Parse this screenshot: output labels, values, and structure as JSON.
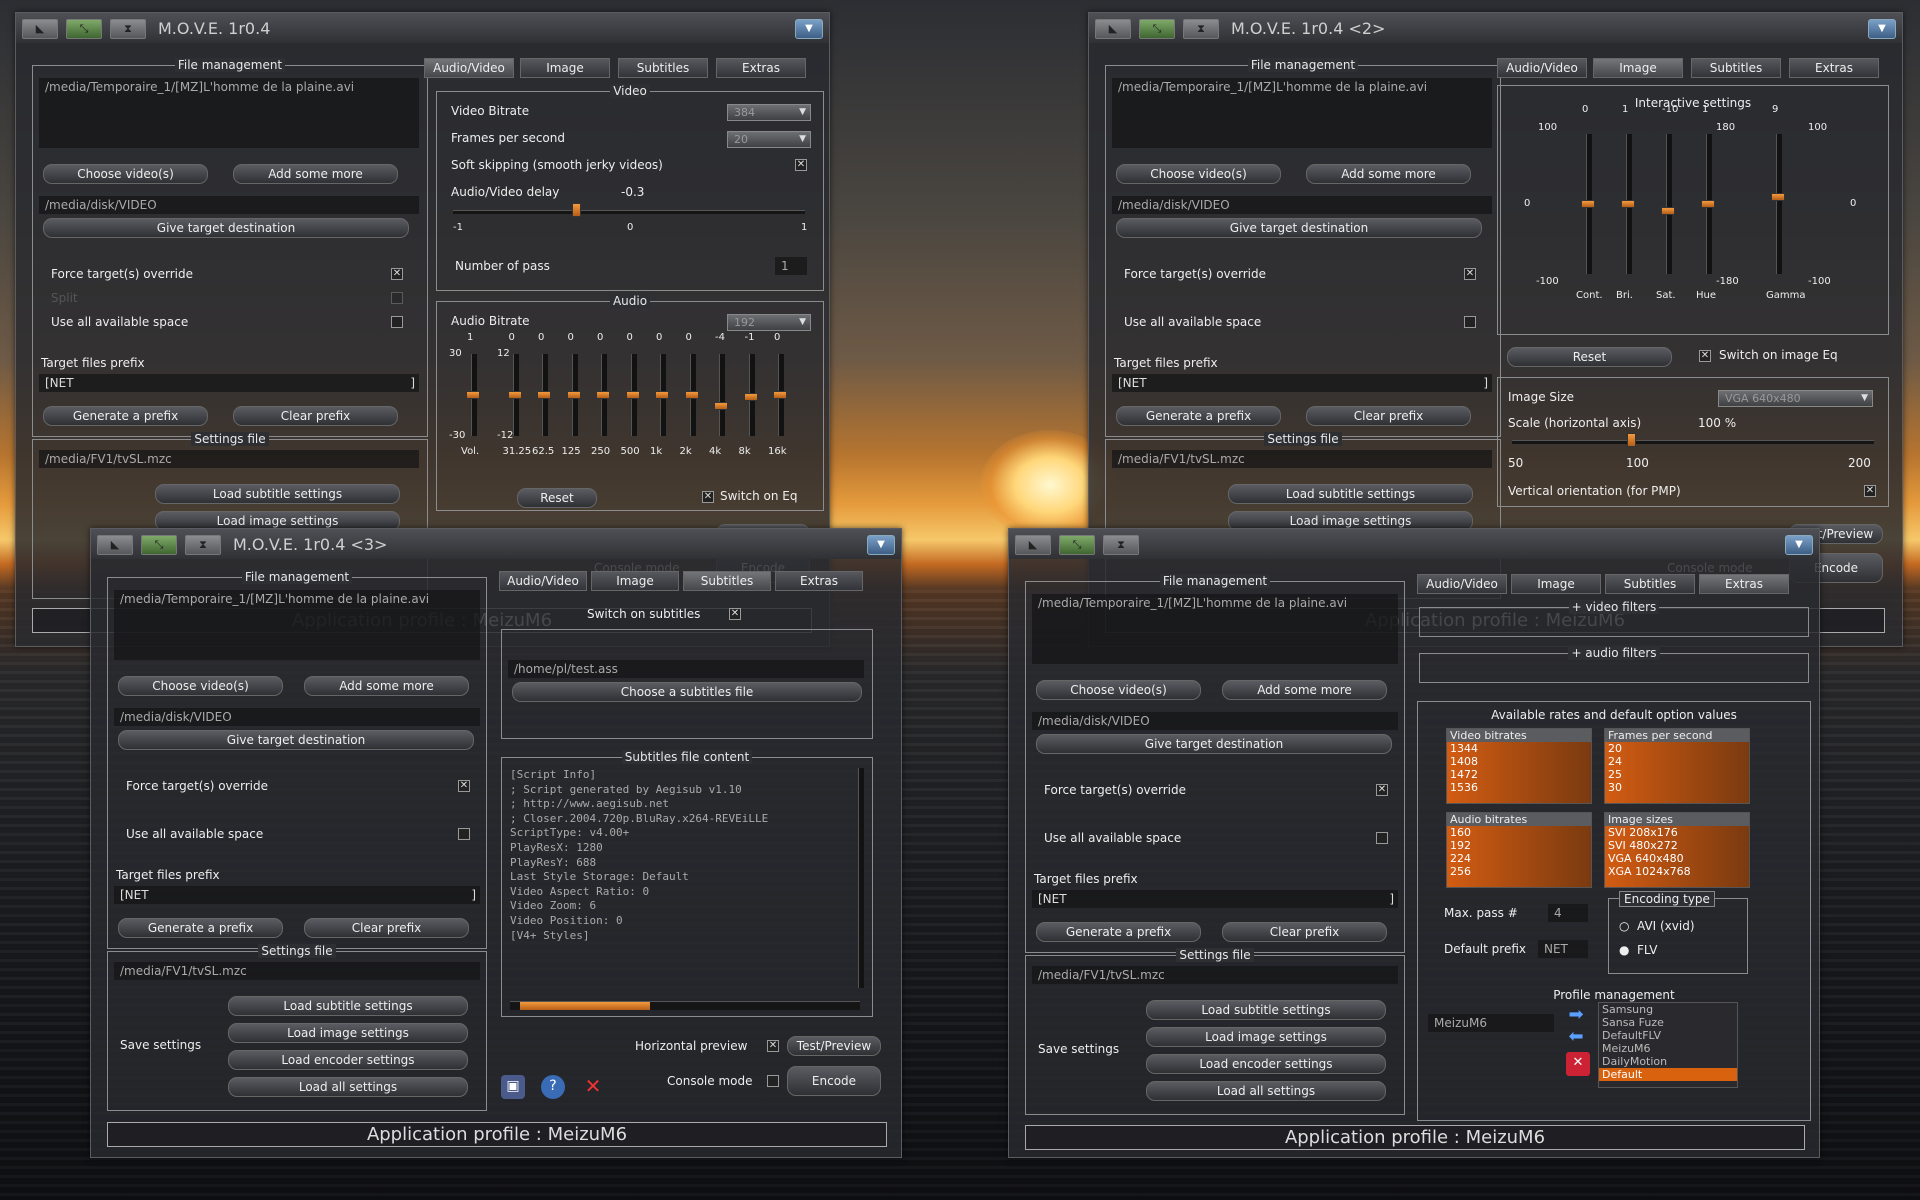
{
  "common": {
    "file_mgmt": "File management",
    "source_path": "/media/Temporaire_1/[MZ]L'homme de la plaine.avi",
    "choose_videos": "Choose video(s)",
    "add_more": "Add some more",
    "dest_path": "/media/disk/VIDEO",
    "give_dest": "Give target destination",
    "force_override": "Force target(s) override",
    "hidden_option": "Split",
    "use_space": "Use all available space",
    "prefix_label": "Target files prefix",
    "prefix_value": "[NET",
    "prefix_end": "]",
    "gen_prefix": "Generate a prefix",
    "clear_prefix": "Clear prefix",
    "settings_file": "Settings file",
    "settings_path": "/media/FV1/tvSL.mzc",
    "save_settings": "Save settings",
    "load_sub": "Load subtitle settings",
    "load_img": "Load image settings",
    "load_enc": "Load encoder settings",
    "load_all": "Load all settings",
    "hpreview": "Horizontal preview",
    "test_preview": "Test/Preview",
    "console_mode": "Console mode",
    "encode": "Encode",
    "profile": "Application profile : MeizuM6",
    "tab_av": "Audio/Video",
    "tab_img": "Image",
    "tab_sub": "Subtitles",
    "tab_extra": "Extras",
    "min_icon": "▼",
    "x": "✕"
  },
  "win1": {
    "title": "M.O.V.E. 1r0.4",
    "video": {
      "legend": "Video",
      "bitrate_label": "Video Bitrate",
      "bitrate": "384",
      "fps_label": "Frames per second",
      "fps": "20",
      "soft_skip": "Soft skipping (smooth jerky videos)",
      "delay_label": "Audio/Video delay",
      "delay": "-0.3",
      "delay_fraction": 0.35,
      "tick_min": "-1",
      "tick_mid": "0",
      "tick_max": "1",
      "pass_label": "Number of pass",
      "pass": "1"
    },
    "audio": {
      "legend": "Audio",
      "bitrate_label": "Audio Bitrate",
      "bitrate": "192",
      "values": [
        "1",
        "0",
        "0",
        "0",
        "0",
        "0",
        "0",
        "0",
        "-4",
        "-1",
        "0"
      ],
      "levels": [
        0.5,
        0.5,
        0.5,
        0.5,
        0.5,
        0.5,
        0.5,
        0.5,
        0.63,
        0.53,
        0.5
      ],
      "freqs": [
        "Vol.",
        "31.25",
        "62.5",
        "125",
        "250",
        "500",
        "1k",
        "2k",
        "4k",
        "8k",
        "16k"
      ],
      "scale_top": "30",
      "scale_bot": "-30",
      "scale2_top": "12",
      "scale2_bot": "-12",
      "reset": "Reset",
      "switch_eq": "Switch on Eq"
    }
  },
  "win2": {
    "title": "M.O.V.E. 1r0.4 <2>",
    "interactive": "Interactive settings",
    "vals": [
      "0",
      "1",
      "-10",
      "1",
      "9"
    ],
    "names": [
      "Cont.",
      "Bri.",
      "Sat.",
      "Hue",
      "Gamma"
    ],
    "levels": [
      0.5,
      0.5,
      0.55,
      0.5,
      0.45
    ],
    "left_top": "100",
    "left_mid": "0",
    "left_bot": "-100",
    "hue_top": "180",
    "hue_bot": "-180",
    "right_top": "100",
    "right_mid": "0",
    "right_bot": "-100",
    "reset": "Reset",
    "switch_img": "Switch on image Eq",
    "img_size": "Image Size",
    "img_size_val": "VGA 640x480",
    "scale_label": "Scale (horizontal axis)",
    "scale_val": "100 %",
    "scale_fraction": 0.33,
    "s_min": "50",
    "s_mid": "100",
    "s_max": "200",
    "vertical": "Vertical orientation (for PMP)"
  },
  "win3": {
    "title": "M.O.V.E. 1r0.4 <3>",
    "switch_sub": "Switch on subtitles",
    "sub_path": "/home/pl/test.ass",
    "choose_sub": "Choose a subtitles file",
    "sub_content": "Subtitles file content",
    "lines": [
      "[Script Info]",
      "; Script generated by Aegisub v1.10",
      "; http://www.aegisub.net",
      "; Closer.2004.720p.BluRay.x264-REVEiLLE",
      "ScriptType: v4.00+",
      "PlayResX: 1280",
      "PlayResY: 688",
      "Last Style Storage: Default",
      "Video Aspect Ratio: 0",
      "Video Zoom: 6",
      "Video Position: 0",
      "",
      "[V4+ Styles]"
    ]
  },
  "win4": {
    "video_filters": "+ video filters",
    "audio_filters": "+ audio filters",
    "rates": "Available rates and default option values",
    "vb": {
      "head": "Video bitrates",
      "items": [
        "1344",
        "1408",
        "1472",
        "1536"
      ]
    },
    "fps": {
      "head": "Frames per second",
      "items": [
        "20",
        "24",
        "25",
        "30"
      ]
    },
    "ab": {
      "head": "Audio bitrates",
      "items": [
        "160",
        "192",
        "224",
        "256"
      ]
    },
    "is": {
      "head": "Image sizes",
      "items": [
        "SVI 208x176",
        "SVI 480x272",
        "VGA 640x480",
        "XGA 1024x768"
      ]
    },
    "max_pass": "Max. pass #",
    "max_pass_val": "4",
    "def_prefix": "Default prefix",
    "def_prefix_val": "NET",
    "enc_type": "Encoding type",
    "avi": "AVI (xvid)",
    "flv": "FLV",
    "profile_mgmt": "Profile management",
    "profile_name": "MeizuM6",
    "profiles": [
      "Samsung",
      "Sansa Fuze",
      "DefaultFLV",
      "MeizuM6",
      "DailyMotion",
      "Default"
    ]
  }
}
